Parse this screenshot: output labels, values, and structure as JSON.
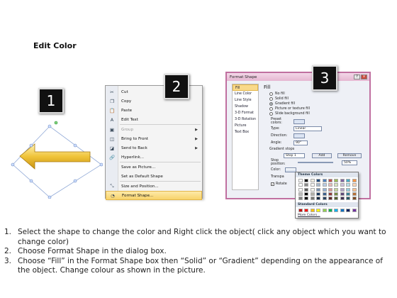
{
  "title": "Edit Color",
  "badges": [
    "1",
    "2",
    "3"
  ],
  "context_menu": {
    "items": [
      {
        "icon": "scissors-icon",
        "glyph": "✂",
        "label": "Cut",
        "disabled": false,
        "submenu": false
      },
      {
        "icon": "copy-icon",
        "glyph": "❐",
        "label": "Copy",
        "disabled": false,
        "submenu": false
      },
      {
        "icon": "paste-icon",
        "glyph": "📋",
        "label": "Paste",
        "disabled": false,
        "submenu": false
      },
      {
        "icon": "edit-text-icon",
        "glyph": "A",
        "label": "Edit Text",
        "disabled": false,
        "submenu": false
      },
      {
        "icon": "group-icon",
        "glyph": "▣",
        "label": "Group",
        "disabled": true,
        "submenu": true
      },
      {
        "icon": "bring-front-icon",
        "glyph": "◫",
        "label": "Bring to Front",
        "disabled": false,
        "submenu": true
      },
      {
        "icon": "send-back-icon",
        "glyph": "◪",
        "label": "Send to Back",
        "disabled": false,
        "submenu": true
      },
      {
        "icon": "hyperlink-icon",
        "glyph": "🔗",
        "label": "Hyperlink...",
        "disabled": false,
        "submenu": false
      },
      {
        "icon": "save-picture-icon",
        "glyph": "",
        "label": "Save as Picture...",
        "disabled": false,
        "submenu": false
      },
      {
        "icon": "default-shape-icon",
        "glyph": "",
        "label": "Set as Default Shape",
        "disabled": false,
        "submenu": false
      },
      {
        "icon": "size-position-icon",
        "glyph": "⤡",
        "label": "Size and Position...",
        "disabled": false,
        "submenu": false
      },
      {
        "icon": "format-shape-icon",
        "glyph": "◔",
        "label": "Format Shape...",
        "disabled": false,
        "submenu": false
      }
    ]
  },
  "dialog": {
    "title": "Format Shape",
    "window_controls": [
      "?",
      "x"
    ],
    "sidebar": [
      "Fill",
      "Line Color",
      "Line Style",
      "Shadow",
      "3-D Format",
      "3-D Rotation",
      "Picture",
      "Text Box"
    ],
    "fill_heading": "Fill",
    "fill_options": [
      {
        "label": "No fill",
        "selected": false
      },
      {
        "label": "Solid fill",
        "selected": false
      },
      {
        "label": "Gradient fill",
        "selected": true
      },
      {
        "label": "Picture or texture fill",
        "selected": false
      },
      {
        "label": "Slide background fill",
        "selected": false
      }
    ],
    "preset_colors_label": "Preset colors:",
    "type_label": "Type:",
    "type_value": "Linear",
    "direction_label": "Direction:",
    "angle_label": "Angle:",
    "angle_value": "90°",
    "gradient_stops_label": "Gradient stops",
    "stop_value": "Stop 1",
    "add_label": "Add",
    "remove_label": "Remove",
    "stop_position_label": "Stop position:",
    "stop_position_value": "50%",
    "color_label": "Color:",
    "transparency_label": "Transpa",
    "rotate_label": "Rotate"
  },
  "theme_popup": {
    "theme_heading": "Theme Colors",
    "standard_heading": "Standard Colors",
    "more_colors": "More Colors...",
    "theme_top_row": [
      "#ffffff",
      "#000000",
      "#eeece1",
      "#1f497d",
      "#4f81bd",
      "#c0504d",
      "#9bbb59",
      "#8064a2",
      "#4bacc6",
      "#f79646"
    ],
    "standard_colors": [
      "#c00000",
      "#ff0000",
      "#ffc000",
      "#ffff00",
      "#92d050",
      "#00b050",
      "#00b0f0",
      "#0070c0",
      "#002060",
      "#7030a0"
    ]
  },
  "steps": [
    {
      "num": "1.",
      "text": "Select the shape to change the color and Right click the object( click any object which you want to change color)"
    },
    {
      "num": "2.",
      "text": "Choose Format Shape in the dialog box."
    },
    {
      "num": "3.",
      "text": "Choose “Fill” in the Format Shape box then “Solid” or “Gradient” depending on the appearance of the object. Change colour as shown in the picture."
    }
  ]
}
